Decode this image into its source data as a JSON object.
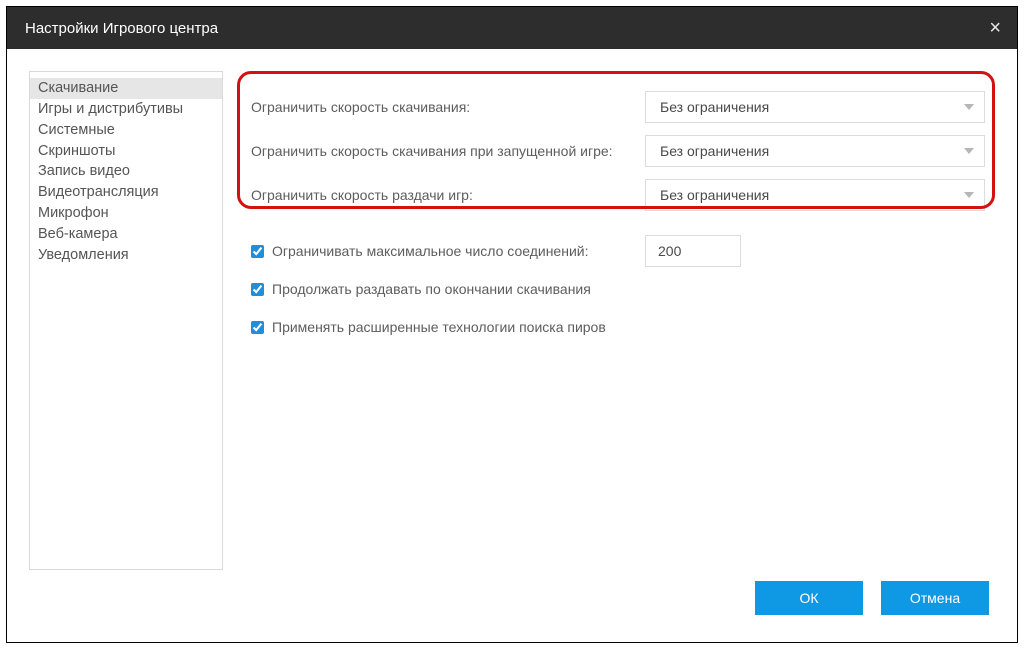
{
  "window": {
    "title": "Настройки Игрового центра"
  },
  "sidebar": {
    "items": [
      {
        "label": "Скачивание"
      },
      {
        "label": "Игры и дистрибутивы"
      },
      {
        "label": "Системные"
      },
      {
        "label": "Скриншоты"
      },
      {
        "label": "Запись видео"
      },
      {
        "label": "Видеотрансляция"
      },
      {
        "label": "Микрофон"
      },
      {
        "label": "Веб-камера"
      },
      {
        "label": "Уведомления"
      }
    ],
    "active_index": 0
  },
  "settings": {
    "limit_download_label": "Ограничить скорость скачивания:",
    "limit_download_value": "Без ограничения",
    "limit_download_ingame_label": "Ограничить скорость скачивания при запущенной игре:",
    "limit_download_ingame_value": "Без ограничения",
    "limit_upload_label": "Ограничить скорость раздачи игр:",
    "limit_upload_value": "Без ограничения",
    "max_conn_label": "Ограничивать максимальное число соединений:",
    "max_conn_value": "200",
    "continue_seed_label": "Продолжать раздавать по окончании скачивания",
    "ext_peers_label": "Применять расширенные технологии поиска пиров"
  },
  "footer": {
    "ok": "ОК",
    "cancel": "Отмена"
  }
}
